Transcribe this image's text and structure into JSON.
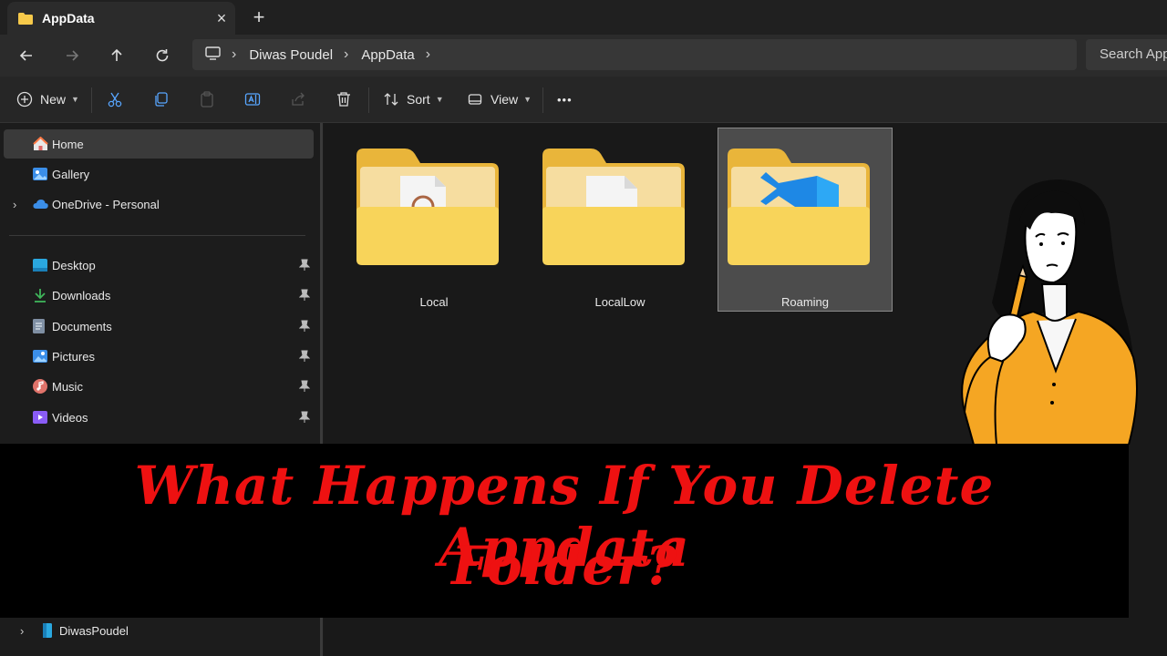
{
  "tab": {
    "title": "AppData",
    "close": "×",
    "new_tab": "+"
  },
  "address": {
    "segments": [
      "Diwas Poudel",
      "AppData"
    ],
    "search_placeholder": "Search AppData"
  },
  "commands": {
    "new": "New",
    "sort": "Sort",
    "view": "View",
    "more": "•••"
  },
  "sidebar": {
    "top": [
      {
        "label": "Home",
        "icon": "home-icon",
        "selected": true
      },
      {
        "label": "Gallery",
        "icon": "gallery-icon"
      },
      {
        "label": "OneDrive - Personal",
        "icon": "cloud-icon",
        "expandable": true
      }
    ],
    "quick": [
      {
        "label": "Desktop",
        "icon": "desktop-icon",
        "pinned": true
      },
      {
        "label": "Downloads",
        "icon": "download-icon",
        "pinned": true
      },
      {
        "label": "Documents",
        "icon": "documents-icon",
        "pinned": true
      },
      {
        "label": "Pictures",
        "icon": "pictures-icon",
        "pinned": true
      },
      {
        "label": "Music",
        "icon": "music-icon",
        "pinned": true
      },
      {
        "label": "Videos",
        "icon": "videos-icon",
        "pinned": true
      }
    ],
    "bottom": [
      {
        "label": "DiwasPoudel",
        "icon": "drive-icon",
        "expandable": true
      }
    ]
  },
  "folders": [
    {
      "name": "Local",
      "overlay": "app-file-icon",
      "selected": false
    },
    {
      "name": "LocalLow",
      "overlay": "blank-file-icon",
      "selected": false
    },
    {
      "name": "Roaming",
      "overlay": "vscode-icon",
      "selected": true
    }
  ],
  "banner": {
    "line1": "What Happens If You Delete Appdata",
    "line2": "Folder?"
  },
  "colors": {
    "accent_red": "#ee1111",
    "folder_yellow": "#f6c94a",
    "vscode_blue": "#1e88e5"
  }
}
